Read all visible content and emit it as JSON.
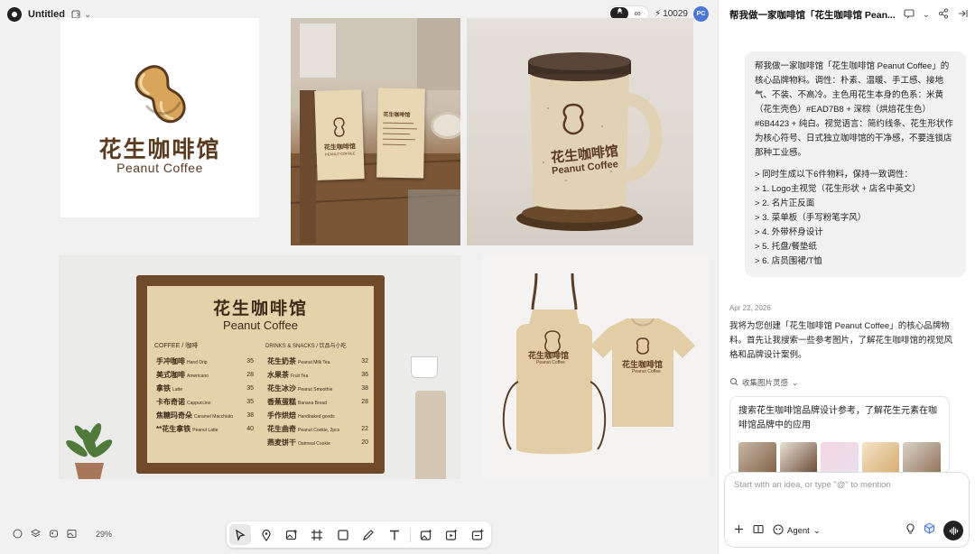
{
  "app": {
    "title": "Untitled",
    "credits": "10029",
    "avatar_initials": "PC",
    "zoom": "29%",
    "accent": "#4a78d9"
  },
  "canvas": {
    "logo": {
      "cn": "花生咖啡馆",
      "en": "Peanut Coffee"
    },
    "cards": {
      "name": "花生咖啡馆",
      "sub": "PEANUT COFFEE",
      "back_title": "花生咖啡馆"
    },
    "mug": {
      "cn": "花生咖啡馆",
      "en": "Peanut Coffee"
    },
    "menu": {
      "title_cn": "花生咖啡馆",
      "title_en": "Peanut Coffee",
      "header_left": "COFFEE / 咖啡",
      "header_right": "DRINKS & SNACKS / 饮品与小吃",
      "left": [
        {
          "cn": "手冲咖啡",
          "en": "Hand Drip",
          "price": "35"
        },
        {
          "cn": "美式咖啡",
          "en": "Americano",
          "price": "28"
        },
        {
          "cn": "拿铁",
          "en": "Latte",
          "price": "35"
        },
        {
          "cn": "卡布奇诺",
          "en": "Cappuccino",
          "price": "35"
        },
        {
          "cn": "焦糖玛奇朵",
          "en": "Caramel Macchiato",
          "price": "38"
        },
        {
          "cn": "**花生拿铁",
          "en": "Peanut Latte",
          "price": "40"
        }
      ],
      "right": [
        {
          "cn": "花生奶茶",
          "en": "Peanut Milk Tea",
          "price": "32"
        },
        {
          "cn": "水果茶",
          "en": "Fruit Tea",
          "price": "36"
        },
        {
          "cn": "花生冰沙",
          "en": "Peanut Smoothie",
          "price": "38"
        },
        {
          "cn": "香蕉蛋糕",
          "en": "Banana Bread",
          "price": "28"
        },
        {
          "cn": "手作烘焙",
          "en": "Handbaked goods",
          "price": ""
        },
        {
          "cn": "花生曲奇",
          "en": "Peanut Cookie, 2pcs",
          "price": "22"
        },
        {
          "cn": "燕麦饼干",
          "en": "Oatmeal Cookie",
          "price": "20"
        }
      ]
    },
    "apparel": {
      "apron_cn": "花生咖啡馆",
      "apron_en": "Peanut Coffee",
      "tee_cn": "花生咖啡馆",
      "tee_en": "Peanut Coffee"
    }
  },
  "toolbar": {
    "tools": [
      "select-tool",
      "pin-tool",
      "image-tool",
      "frame-tool",
      "shape-tool",
      "pen-tool",
      "text-tool",
      "image-gen-tool",
      "video-gen-tool",
      "upload-tool"
    ]
  },
  "chat": {
    "title": "帮我做一家咖啡馆「花生咖啡馆 Pean...",
    "user_message": {
      "intro": "帮我做一家咖啡馆「花生咖啡馆 Peanut Coffee」的核心品牌物料。调性：朴素、温暖、手工感、接地气、不装、不高冷。主色用花生本身的色系：米黄（花生壳色）#EAD7B8 + 深棕（烘焙花生色）#6B4423 + 纯白。视觉语言：简约线条、花生形状作为核心符号、日式独立咖啡馆的干净感，不要连锁店那种工业感。",
      "list": [
        "> 同时生成以下6件物料，保持一致调性：",
        "> 1. Logo主视觉（花生形状 + 店名中英文）",
        "> 2. 名片正反面",
        "> 3. 菜单板（手写粉笔字风）",
        "> 4. 外带杯身设计",
        "> 5. 托盘/餐垫纸",
        "> 6. 店员围裙/T恤"
      ]
    },
    "date": "Apr 22, 2026",
    "assistant_reply": "我将为您创建「花生咖啡馆 Peanut Coffee」的核心品牌物料。首先让我搜索一些参考图片，了解花生咖啡馆的视觉风格和品牌设计案例。",
    "collect_label": "收集图片灵感",
    "search_text": "搜索花生咖啡馆品牌设计参考，了解花生元素在咖啡馆品牌中的应用",
    "composer_placeholder": "Start with an idea, or type \"@\" to mention",
    "agent_label": "Agent"
  },
  "colors": {
    "peanut_beige": "#EAD7B8",
    "roast_brown": "#6B4423"
  }
}
